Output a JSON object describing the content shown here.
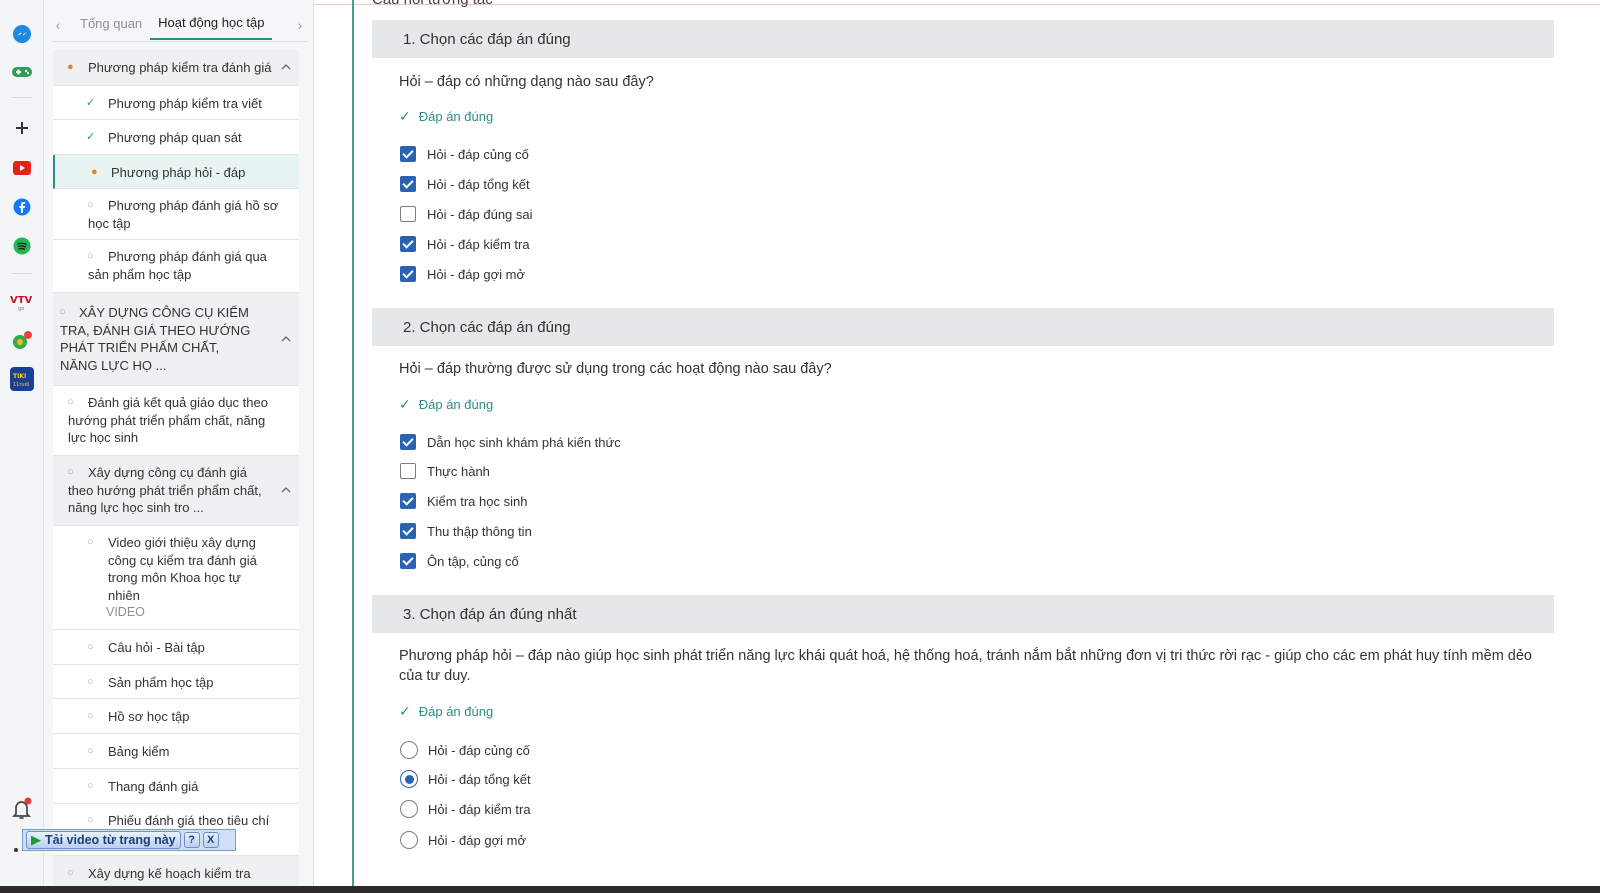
{
  "sidebar": {
    "tabs": {
      "overview": "Tổng quan",
      "activity": "Hoạt động học tập"
    },
    "items": [
      {
        "label": "Phương pháp kiểm tra đánh giá",
        "status": "in-progress"
      },
      {
        "label": "Phương pháp kiểm tra viết",
        "status": "done"
      },
      {
        "label": "Phương pháp quan sát",
        "status": "done"
      },
      {
        "label": "Phương pháp hỏi - đáp",
        "status": "current"
      },
      {
        "label": "Phương pháp đánh giá hồ sơ học tập",
        "status": "todo"
      },
      {
        "label": "Phương pháp đánh giá qua sản phẩm học tập",
        "status": "todo"
      },
      {
        "label": "XÂY DỰNG CÔNG CỤ KIỂM TRA, ĐÁNH GIÁ THEO HƯỚNG PHÁT TRIỂN PHẨM CHẤT, NĂNG LỰC HỌ ...",
        "status": "todo"
      },
      {
        "label": "Đánh giá kết quả giáo dục theo hướng phát triển phẩm chất, năng lực học sinh",
        "status": "todo"
      },
      {
        "label": "Xây dựng công cụ đánh giá theo hướng phát triển phẩm chất, năng lực học sinh tro ...",
        "status": "todo"
      },
      {
        "label": "Video giới thiệu xây dựng công cụ kiểm tra đánh giá trong môn Khoa học tự nhiên",
        "sub": "VIDEO",
        "status": "todo"
      },
      {
        "label": "Câu hỏi - Bài tập",
        "status": "todo"
      },
      {
        "label": "Sản phẩm học tập",
        "status": "todo"
      },
      {
        "label": "Hồ sơ học tập",
        "status": "todo"
      },
      {
        "label": "Bảng kiểm",
        "status": "todo"
      },
      {
        "label": "Thang đánh giá",
        "status": "todo"
      },
      {
        "label": "Phiếu đánh giá theo tiêu chí",
        "status": "todo"
      },
      {
        "label": "Xây dựng kế hoạch kiểm tra",
        "status": "todo"
      }
    ]
  },
  "download_bar": {
    "label": "Tải video từ trang này",
    "help": "?",
    "close": "X"
  },
  "main": {
    "section_title": "Câu hỏi tương tác",
    "answer_label": "Đáp án đúng",
    "questions": [
      {
        "header": "1. Chọn các đáp án đúng",
        "text": "Hỏi – đáp có những dạng nào sau đây?",
        "type": "checkbox",
        "options": [
          {
            "label": "Hỏi - đáp củng cố",
            "checked": true
          },
          {
            "label": "Hỏi - đáp tổng kết",
            "checked": true
          },
          {
            "label": "Hỏi - đáp đúng sai",
            "checked": false
          },
          {
            "label": "Hỏi - đáp kiểm tra",
            "checked": true
          },
          {
            "label": "Hỏi - đáp gợi mở",
            "checked": true
          }
        ]
      },
      {
        "header": "2. Chọn các đáp án đúng",
        "text": "Hỏi – đáp thường được sử dụng trong các hoạt động nào sau đây?",
        "type": "checkbox",
        "options": [
          {
            "label": "Dẫn học sinh khám phá kiến thức",
            "checked": true
          },
          {
            "label": "Thực hành",
            "checked": false
          },
          {
            "label": "Kiểm tra học sinh",
            "checked": true
          },
          {
            "label": "Thu thập thông tin",
            "checked": true
          },
          {
            "label": "Ôn tập, củng cố",
            "checked": true
          }
        ]
      },
      {
        "header": "3. Chọn đáp án đúng nhất",
        "text": "Phương pháp hỏi – đáp nào giúp học sinh phát triển năng lực khái quát hoá, hệ thống hoá, tránh nắm bắt những đơn vị tri thức rời rạc - giúp cho các em phát huy tính mềm dẻo của tư duy.",
        "type": "radio",
        "options": [
          {
            "label": "Hỏi - đáp củng cố",
            "checked": false
          },
          {
            "label": "Hỏi - đáp tổng kết",
            "checked": true
          },
          {
            "label": "Hỏi - đáp kiểm tra",
            "checked": false
          },
          {
            "label": "Hỏi - đáp gợi mở",
            "checked": false
          }
        ]
      }
    ]
  },
  "appbar": {
    "icons": [
      "messenger-icon",
      "game-controller-icon",
      "plus-icon",
      "youtube-icon",
      "facebook-icon",
      "spotify-icon",
      "vtv-go-icon",
      "maps-icon",
      "tiki-icon",
      "bell-icon"
    ],
    "colors": {
      "messenger": "#1e88e5",
      "game": "#2e9d56",
      "youtube": "#e62117",
      "facebook": "#1877f2",
      "spotify": "#1db954",
      "vtv": "#c8102e",
      "tiki": "#1a3f97",
      "notify": "#e53935"
    }
  },
  "colors": {
    "accent": "#2a8f83",
    "checked": "#2a63b0",
    "in_progress": "#e8823a"
  }
}
